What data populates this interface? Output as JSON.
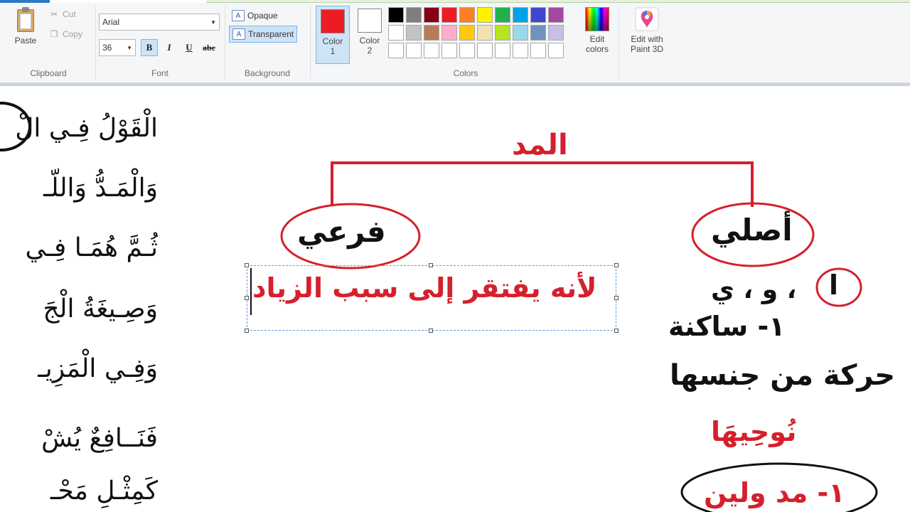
{
  "ribbon": {
    "clipboard": {
      "group_label": "Clipboard",
      "paste_label": "Paste",
      "cut_label": "Cut",
      "copy_label": "Copy"
    },
    "font": {
      "group_label": "Font",
      "family_value": "Arial",
      "size_value": "36",
      "bold_label": "B",
      "italic_label": "I",
      "underline_label": "U",
      "strike_label": "abc"
    },
    "background": {
      "group_label": "Background",
      "opaque_label": "Opaque",
      "transparent_label": "Transparent",
      "opaque_icon_text": "A",
      "transparent_icon_text": "A"
    },
    "colors": {
      "group_label": "Colors",
      "color1_label": "Color",
      "color1_num": "1",
      "color2_label": "Color",
      "color2_num": "2",
      "color1_value": "#ed1c24",
      "color2_value": "#ffffff",
      "edit_colors_line1": "Edit",
      "edit_colors_line2": "colors",
      "paint3d_line1": "Edit with",
      "paint3d_line2": "Paint 3D",
      "palette": [
        "#000000",
        "#7f7f7f",
        "#880015",
        "#ed1c24",
        "#ff7f27",
        "#fff200",
        "#22b14c",
        "#00a2e8",
        "#3f48cc",
        "#a349a4",
        "#ffffff",
        "#c3c3c3",
        "#b97a57",
        "#ffaec9",
        "#ffc90e",
        "#efe4b0",
        "#b5e61d",
        "#99d9ea",
        "#7092be",
        "#c8bfe7",
        "#ffffff",
        "#ffffff",
        "#ffffff",
        "#ffffff",
        "#ffffff",
        "#ffffff",
        "#ffffff",
        "#ffffff",
        "#ffffff",
        "#ffffff"
      ]
    }
  },
  "canvas": {
    "poem_lines": [
      "الْقَوْلُ فِـي الْ",
      "وَالْمَـدُّ وَاللّـ",
      "ثُـمَّ هُمَـا فِـي",
      "وَصِـيغَةُ الْجَ",
      "وَفِـي الْمَزِيـ",
      "فَنَــافِعٌ يُشْ",
      "كَمِثْـلِ مَحْـ"
    ],
    "diagram": {
      "root": "المد",
      "branch_left": "فرعي",
      "branch_right": "أصلي",
      "left_text": "لأنه يفتقر إلى سبب الزياد",
      "right_letters_circled": "ا",
      "right_letters_rest": "، و ، ي",
      "right_line2": "١- ساكنة",
      "right_line3": "حركة من جنسها",
      "example_word": "نُوحِيهَا",
      "bottom_circled": "١- مد ولين"
    },
    "colors": {
      "ink_red": "#d5202c",
      "ink_black": "#111111"
    }
  }
}
